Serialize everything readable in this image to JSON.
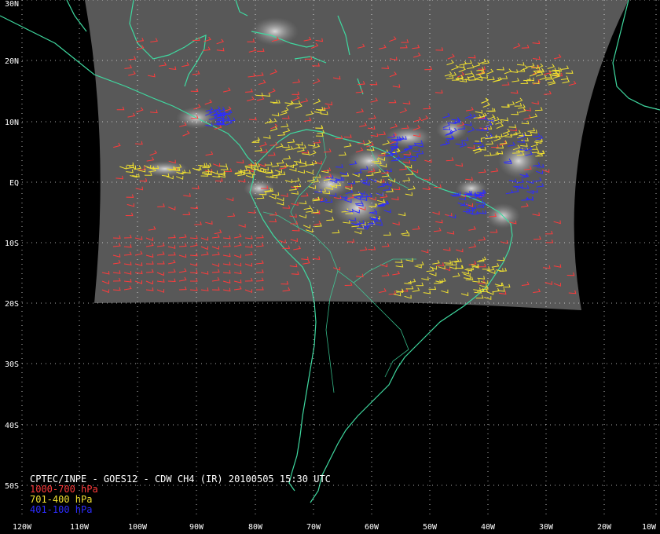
{
  "header": {
    "title": "CPTEC/INPE - GOES12 - CDW CH4 (IR) 20100505 15:30 UTC"
  },
  "legend": {
    "items": [
      {
        "label": "1000-700 hPa",
        "color": "#ff3b3b"
      },
      {
        "label": "701-400 hPa",
        "color": "#f0e030"
      },
      {
        "label": "401-100 hPa",
        "color": "#2d2dff"
      }
    ]
  },
  "axes": {
    "lat_labels": [
      "30N",
      "20N",
      "10N",
      "EQ",
      "10S",
      "20S",
      "30S",
      "40S",
      "50S"
    ],
    "lon_labels": [
      "120W",
      "110W",
      "100W",
      "90W",
      "80W",
      "70W",
      "60W",
      "50W",
      "40W",
      "30W",
      "20W",
      "10W"
    ]
  },
  "colors": {
    "background": "#000000",
    "coastline": "#3fd9a0",
    "grid": "#ffffff",
    "satellite_image": "#5a5a5a"
  }
}
